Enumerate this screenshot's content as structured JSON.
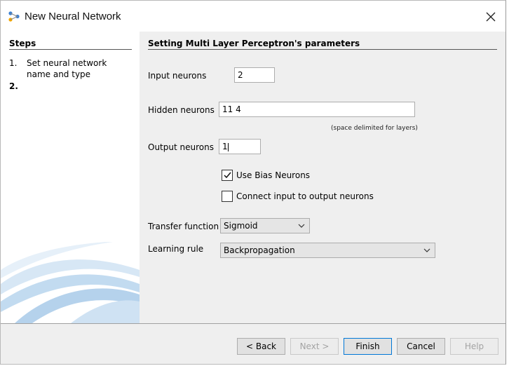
{
  "window": {
    "title": "New Neural Network"
  },
  "steps": {
    "title": "Steps",
    "items": [
      {
        "num": "1.",
        "label": "Set neural network name and type"
      },
      {
        "num": "2.",
        "label": ""
      }
    ]
  },
  "content": {
    "title": "Setting Multi Layer Perceptron's parameters",
    "input_neurons": {
      "label": "Input neurons",
      "value": "2"
    },
    "hidden_neurons": {
      "label": "Hidden neurons",
      "value": "11 4",
      "hint": "(space delimited for layers)"
    },
    "output_neurons": {
      "label": "Output neurons",
      "value": "1"
    },
    "use_bias": {
      "label": "Use Bias Neurons",
      "checked": true
    },
    "connect_io": {
      "label": "Connect input to output neurons",
      "checked": false
    },
    "transfer_function": {
      "label": "Transfer function",
      "value": "Sigmoid"
    },
    "learning_rule": {
      "label": "Learning rule",
      "value": "Backpropagation"
    }
  },
  "footer": {
    "back": "< Back",
    "next": "Next >",
    "finish": "Finish",
    "cancel": "Cancel",
    "help": "Help"
  },
  "colors": {
    "accent": "#0078d7",
    "panel": "#efefef"
  }
}
